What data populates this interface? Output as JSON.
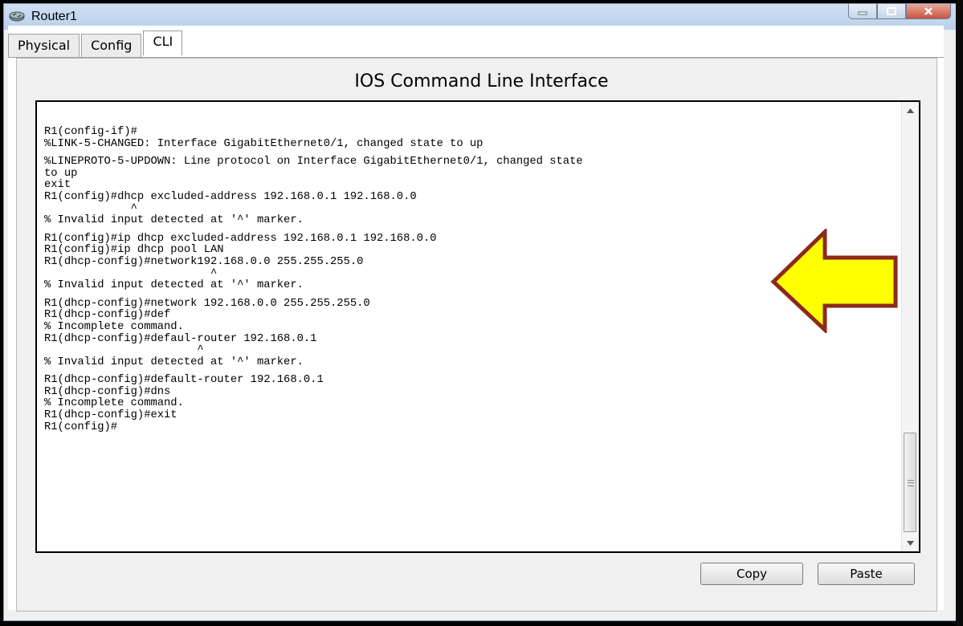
{
  "window": {
    "title": "Router1"
  },
  "tabs": [
    {
      "label": "Physical"
    },
    {
      "label": "Config"
    },
    {
      "label": "CLI"
    }
  ],
  "heading": "IOS Command Line Interface",
  "terminal": {
    "lines": [
      "R1(config-if)#",
      "%LINK-5-CHANGED: Interface GigabitEthernet0/1, changed state to up",
      "",
      "%LINEPROTO-5-UPDOWN: Line protocol on Interface GigabitEthernet0/1, changed state",
      "to up",
      "exit",
      "R1(config)#dhcp excluded-address 192.168.0.1 192.168.0.0",
      "             ^",
      "% Invalid input detected at '^' marker.",
      "",
      "R1(config)#ip dhcp excluded-address 192.168.0.1 192.168.0.0",
      "R1(config)#ip dhcp pool LAN",
      "R1(dhcp-config)#network192.168.0.0 255.255.255.0",
      "                         ^",
      "% Invalid input detected at '^' marker.",
      "",
      "R1(dhcp-config)#network 192.168.0.0 255.255.255.0",
      "R1(dhcp-config)#def",
      "% Incomplete command.",
      "R1(dhcp-config)#defaul-router 192.168.0.1",
      "                       ^",
      "% Invalid input detected at '^' marker.",
      "",
      "R1(dhcp-config)#default-router 192.168.0.1",
      "R1(dhcp-config)#dns",
      "% Incomplete command.",
      "R1(dhcp-config)#exit",
      "R1(config)#"
    ]
  },
  "buttons": {
    "copy": "Copy",
    "paste": "Paste"
  },
  "colors": {
    "arrow_fill": "#ffff00",
    "arrow_stroke": "#8b2a1a",
    "titlebar": "#c3d6ec"
  },
  "icons": {
    "app": "router-icon",
    "annotation": "yellow-left-arrow"
  }
}
